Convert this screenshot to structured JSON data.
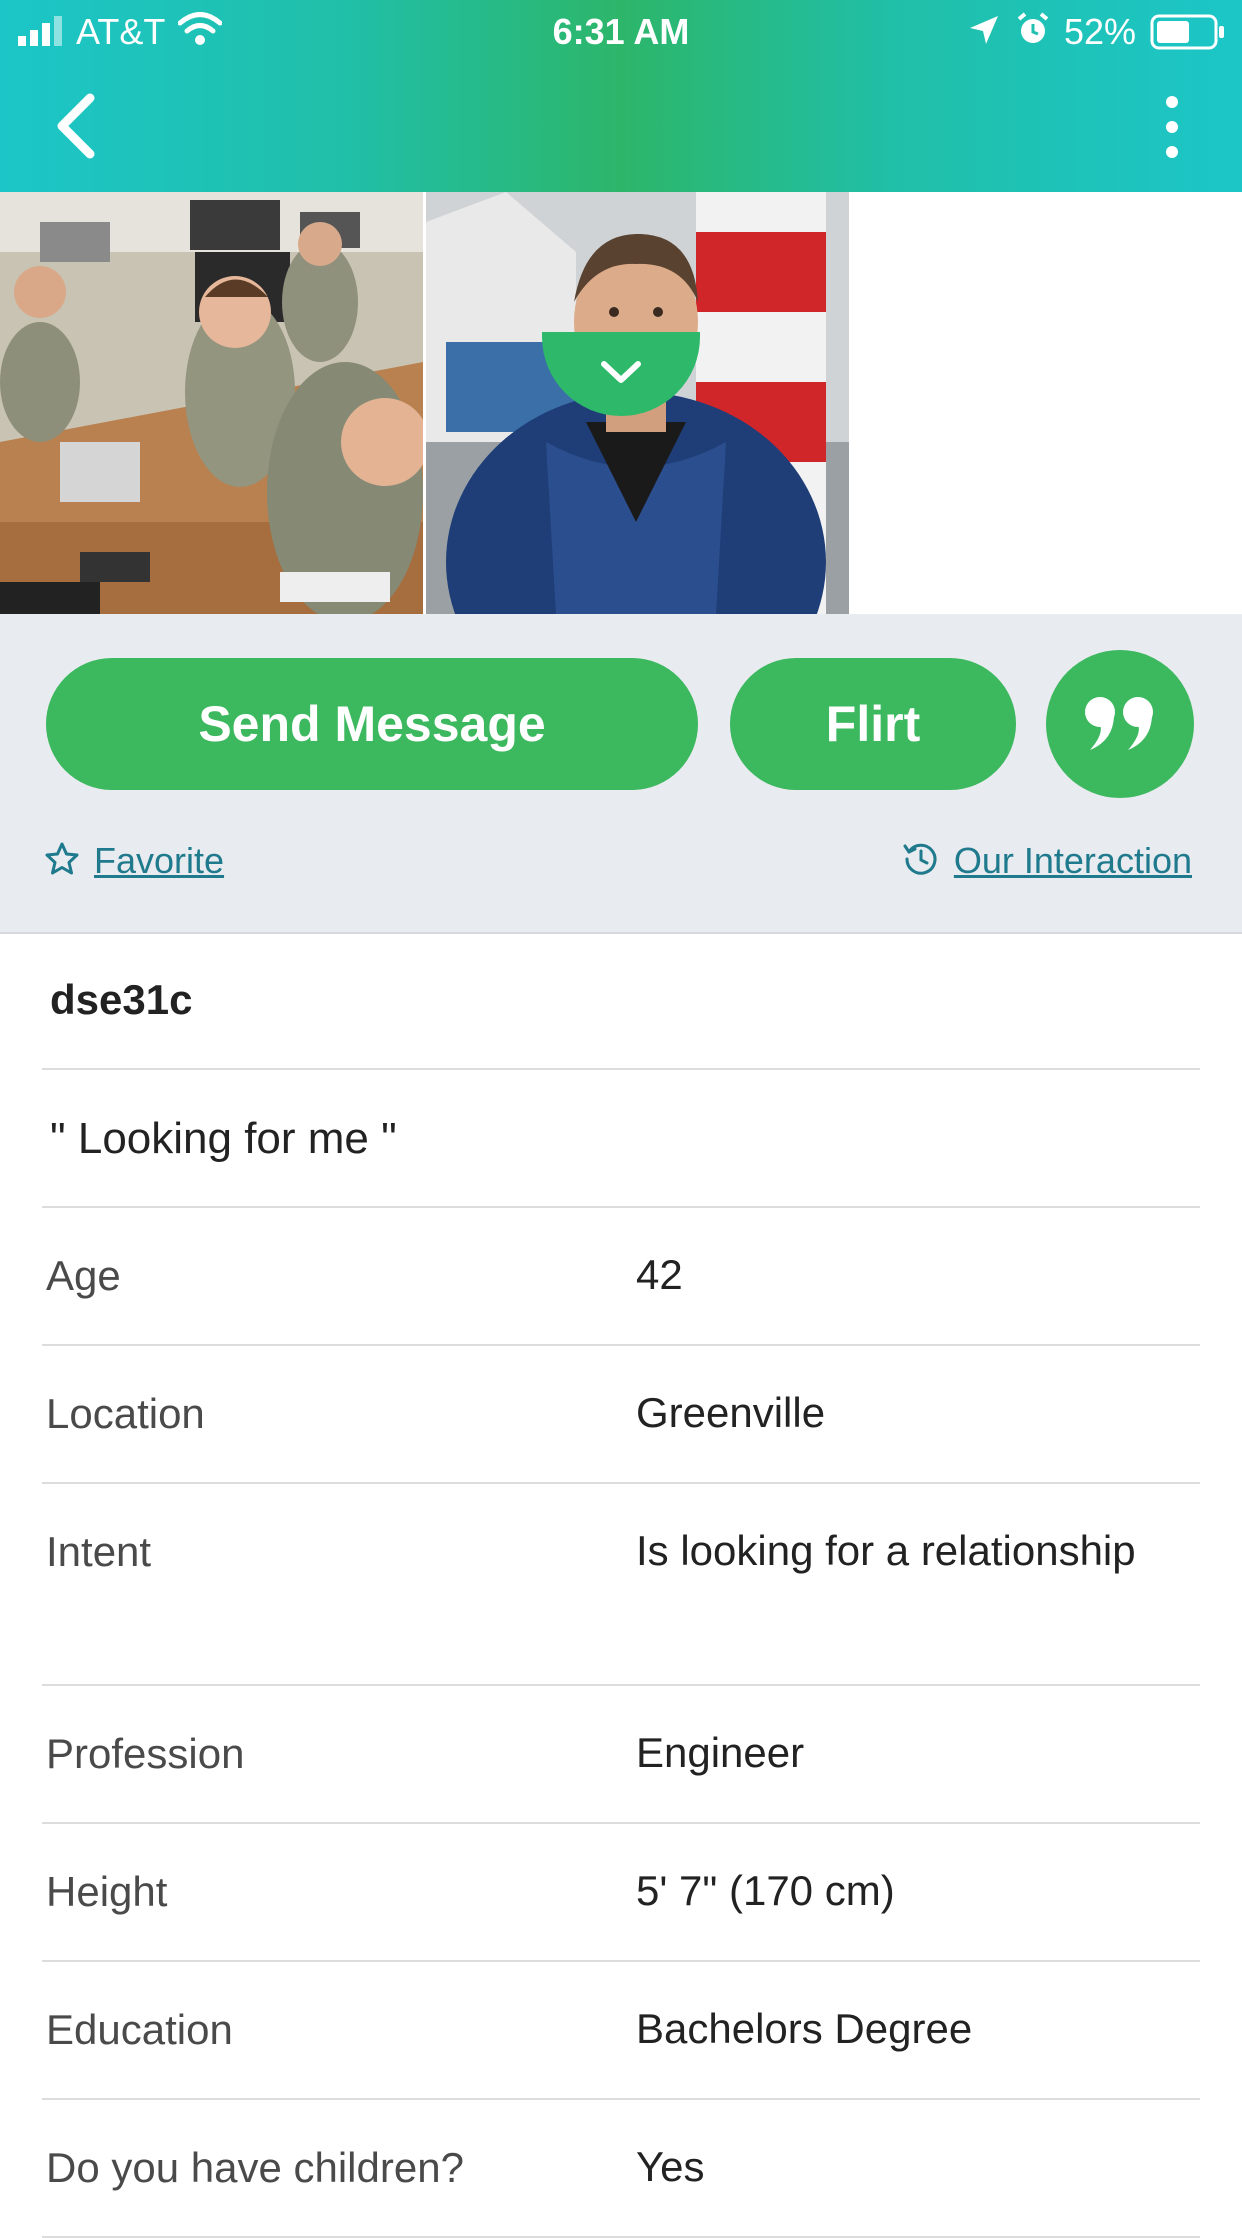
{
  "status_bar": {
    "carrier": "AT&T",
    "time": "6:31 AM",
    "battery": "52%"
  },
  "colors": {
    "accent_green": "#3cb85e",
    "header_teal": "#1cc6c8",
    "link_teal": "#1e7a8c"
  },
  "actions": {
    "send_message": "Send Message",
    "flirt": "Flirt",
    "favorite": "Favorite",
    "interaction": "Our Interaction"
  },
  "profile": {
    "username": "dse31c",
    "headline": "\" Looking for me \"",
    "fields": [
      {
        "label": "Age",
        "value": "42"
      },
      {
        "label": "Location",
        "value": "Greenville"
      },
      {
        "label": "Intent",
        "value": "Is looking for a relationship"
      },
      {
        "label": "Profession",
        "value": "Engineer"
      },
      {
        "label": "Height",
        "value": "5' 7\" (170 cm)"
      },
      {
        "label": "Education",
        "value": "Bachelors Degree"
      },
      {
        "label": "Do you have children?",
        "value": "Yes"
      }
    ]
  }
}
